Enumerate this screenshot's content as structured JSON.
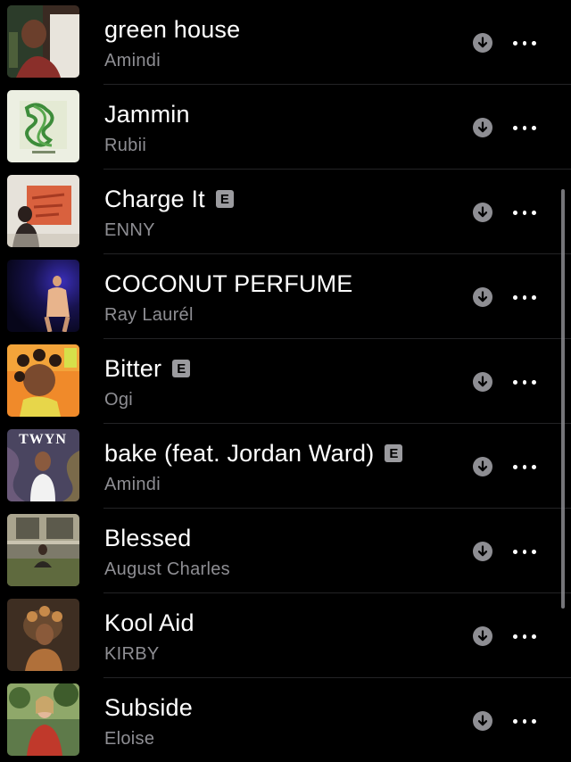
{
  "songs": [
    {
      "title": "green house",
      "artist": "Amindi",
      "explicit": false,
      "art_icon": "album-art-green-house"
    },
    {
      "title": "Jammin",
      "artist": "Rubii",
      "explicit": false,
      "art_icon": "album-art-jammin"
    },
    {
      "title": "Charge It",
      "artist": "ENNY",
      "explicit": true,
      "explicit_label": "E",
      "art_icon": "album-art-charge-it"
    },
    {
      "title": "COCONUT PERFUME",
      "artist": "Ray Laurél",
      "explicit": false,
      "art_icon": "album-art-coconut-perfume"
    },
    {
      "title": "Bitter",
      "artist": "Ogi",
      "explicit": true,
      "explicit_label": "E",
      "art_icon": "album-art-bitter"
    },
    {
      "title": "bake (feat. Jordan Ward)",
      "artist": "Amindi",
      "explicit": true,
      "explicit_label": "E",
      "art_icon": "album-art-bake"
    },
    {
      "title": "Blessed",
      "artist": "August Charles",
      "explicit": false,
      "art_icon": "album-art-blessed"
    },
    {
      "title": "Kool Aid",
      "artist": "KIRBY",
      "explicit": false,
      "art_icon": "album-art-kool-aid"
    },
    {
      "title": "Subside",
      "artist": "Eloise",
      "explicit": false,
      "art_icon": "album-art-subside"
    }
  ],
  "row_icons": {
    "download": "download-arrow-icon",
    "more": "more-options-icon"
  },
  "colors": {
    "background": "#000000",
    "title": "#ffffff",
    "artist": "#8e8e93",
    "explicit_badge": "#9b9b9f",
    "icon_circle": "#8e8e93",
    "divider": "#232325"
  },
  "cover_text": {
    "bake": "TWYN"
  }
}
